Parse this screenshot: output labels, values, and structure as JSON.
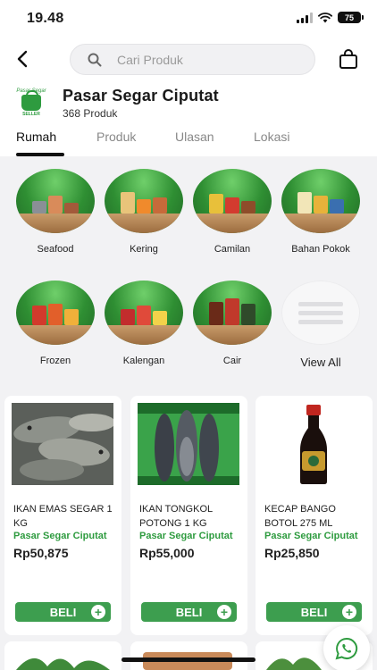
{
  "status_bar": {
    "time": "19.48",
    "battery": "75"
  },
  "search": {
    "placeholder": "Cari Produk"
  },
  "store": {
    "name": "Pasar Segar Ciputat",
    "product_count": "368 Produk",
    "logo_top": "Pasar Segar",
    "logo_bottom": "SELLER"
  },
  "tabs": [
    {
      "label": "Rumah",
      "active": true
    },
    {
      "label": "Produk",
      "active": false
    },
    {
      "label": "Ulasan",
      "active": false
    },
    {
      "label": "Lokasi",
      "active": false
    }
  ],
  "categories": [
    {
      "label": "Seafood",
      "icon": "seafood-icon"
    },
    {
      "label": "Kering",
      "icon": "dry-goods-icon"
    },
    {
      "label": "Camilan",
      "icon": "snacks-icon"
    },
    {
      "label": "Bahan Pokok",
      "icon": "staples-icon"
    },
    {
      "label": "Frozen",
      "icon": "frozen-icon"
    },
    {
      "label": "Kalengan",
      "icon": "canned-icon"
    },
    {
      "label": "Cair",
      "icon": "liquid-icon"
    }
  ],
  "view_all": {
    "label": "View All"
  },
  "products": [
    {
      "name": "IKAN EMAS SEGAR 1 KG",
      "store": "Pasar Segar Ciputat",
      "price": "Rp50,875",
      "buy_label": "BELI"
    },
    {
      "name": "IKAN  TONGKOL POTONG 1 KG",
      "store": "Pasar Segar Ciputat",
      "price": "Rp55,000",
      "buy_label": "BELI"
    },
    {
      "name": "KECAP BANGO BOTOL 275 ML",
      "store": "Pasar Segar Ciputat",
      "price": "Rp25,850",
      "buy_label": "BELI"
    }
  ],
  "colors": {
    "brand_green": "#2e9b3f",
    "button_green": "#3d9e4f",
    "background": "#f2f2f4"
  }
}
